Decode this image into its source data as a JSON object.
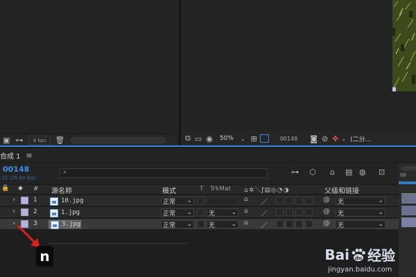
{
  "project": {
    "bpc_label": "8 bpc"
  },
  "viewer": {
    "zoom": "50%",
    "frame": "00148",
    "resolution": "(二分..."
  },
  "timeline": {
    "tab_label": "合成 1",
    "menu_icon": "≡",
    "timecode": "00148",
    "fps_label": ":22 (25.00 fps)",
    "search_placeholder": "",
    "ruler_label": "00"
  },
  "columns": {
    "hash": "#",
    "source_name": "源名称",
    "mode": "模式",
    "t": "T",
    "trkmat": "TrkMat",
    "parent": "父级和链接"
  },
  "layers": [
    {
      "num": "1",
      "name": "10.jpg",
      "mode": "正常",
      "trkmat": "",
      "parent": "无",
      "selected": false
    },
    {
      "num": "2",
      "name": "1.jpg",
      "mode": "正常",
      "trkmat": "无",
      "parent": "无",
      "selected": false
    },
    {
      "num": "3",
      "name": "3.jpg",
      "mode": "正常",
      "trkmat": "无",
      "parent": "无",
      "selected": true
    }
  ],
  "overlay": {
    "n_glyph": "n"
  },
  "watermark": {
    "brand": "Bai",
    "brand2": "经验",
    "url": "jingyan.baidu.com"
  }
}
